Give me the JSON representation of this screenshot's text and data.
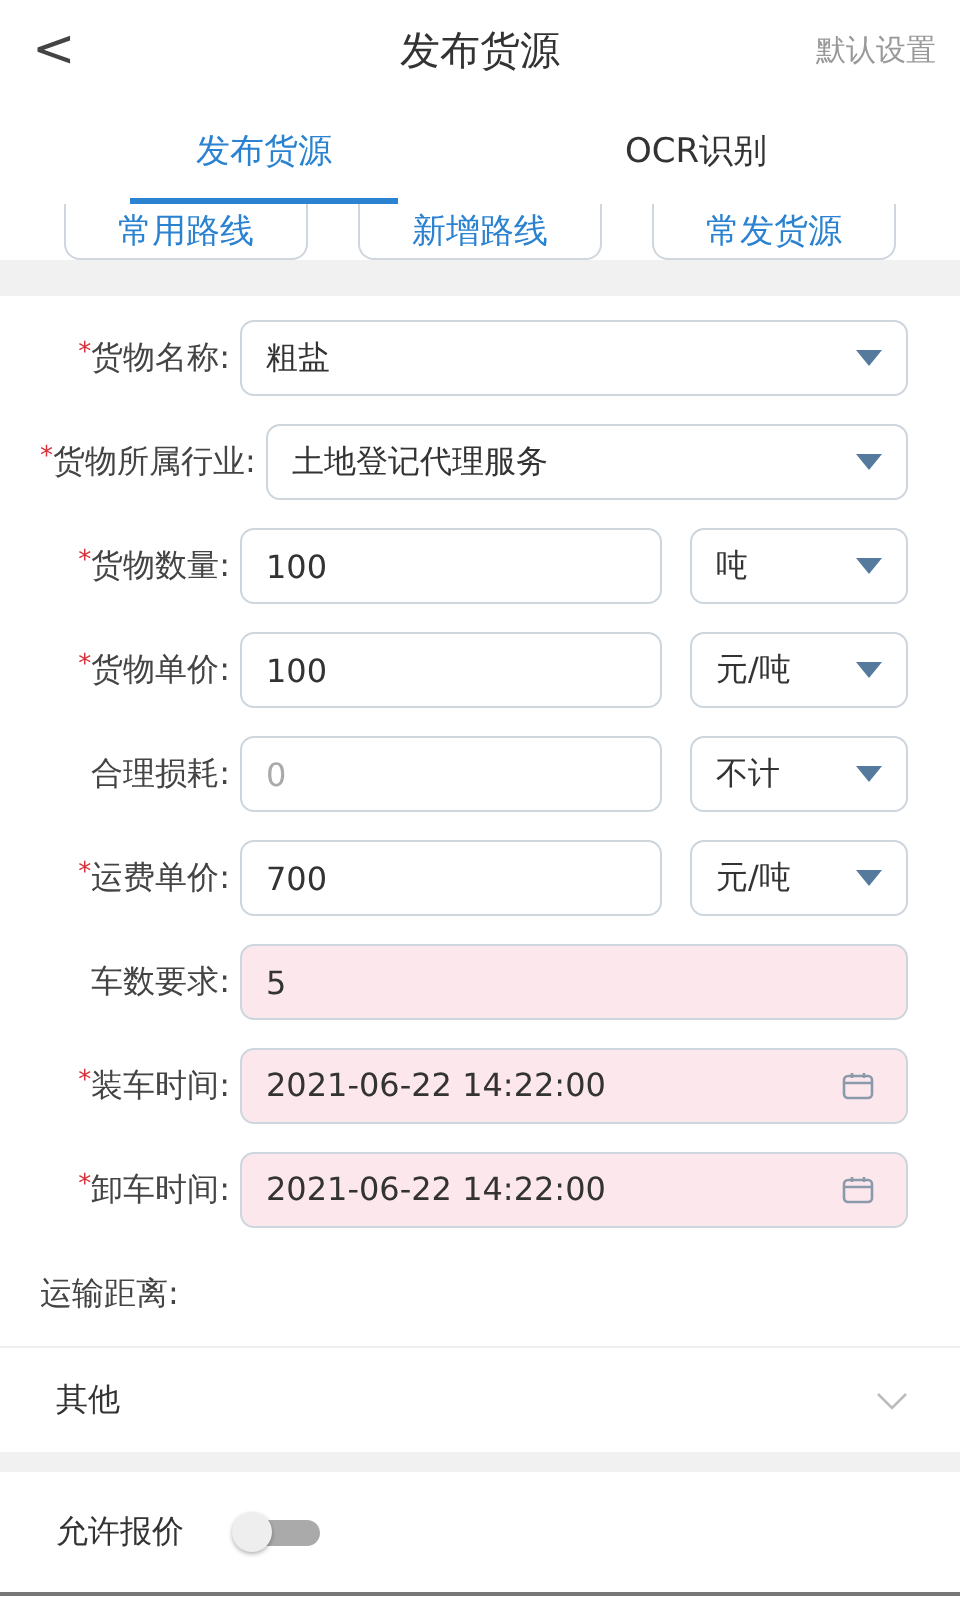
{
  "header": {
    "back": "<",
    "title": "发布货源",
    "action": "默认设置"
  },
  "tabs": [
    {
      "label": "发布货源",
      "selected": true
    },
    {
      "label": "OCR识别",
      "selected": false
    }
  ],
  "route_buttons": [
    "常用路线",
    "新增路线",
    "常发货源"
  ],
  "form": [
    {
      "kind": "select",
      "required_mark": "*",
      "label": "货物名称:",
      "value": "粗盐"
    },
    {
      "kind": "select",
      "required_mark": "*",
      "label": "货物所属行业:",
      "value": "土地登记代理服务"
    },
    {
      "kind": "unit",
      "required_mark": "*",
      "label": "货物数量:",
      "value": "100",
      "unit": "吨"
    },
    {
      "kind": "unit",
      "required_mark": "*",
      "label": "货物单价:",
      "value": "100",
      "unit": "元/吨"
    },
    {
      "kind": "unit",
      "label": "合理损耗:",
      "placeholder": "0",
      "unit": "不计"
    },
    {
      "kind": "unit",
      "required_mark": "*",
      "label": "运费单价:",
      "value": "700",
      "unit": "元/吨"
    },
    {
      "kind": "input",
      "label": "车数要求:",
      "value": "5",
      "highlighted": true
    },
    {
      "kind": "date",
      "required_mark": "*",
      "label": "装车时间:",
      "value": "2021-06-22 14:22:00",
      "highlighted": true
    },
    {
      "kind": "date",
      "required_mark": "*",
      "label": "卸车时间:",
      "value": "2021-06-22 14:22:00",
      "highlighted": true
    },
    {
      "kind": "text",
      "label": "运输距离:"
    }
  ],
  "other": {
    "label": "其他",
    "expanded": false
  },
  "quote": {
    "label": "允许报价",
    "on": false
  }
}
